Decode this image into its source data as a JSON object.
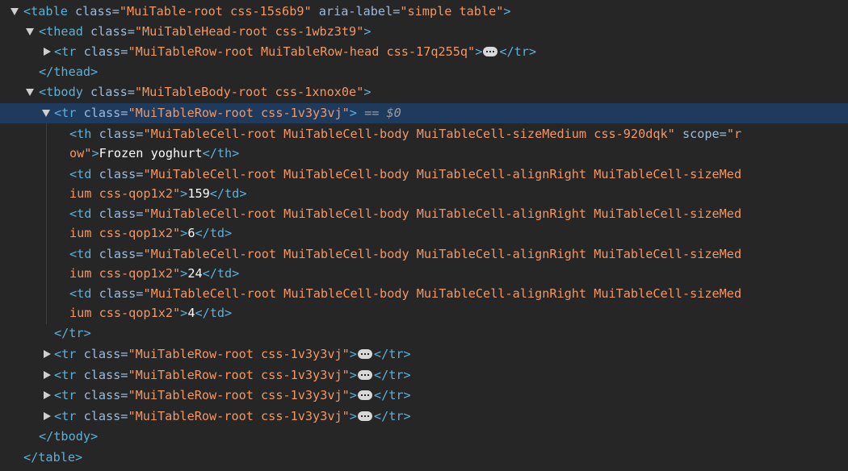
{
  "nodes": {
    "table_open": {
      "tag": "<table",
      "a1": " class=",
      "v1": "\"MuiTable-root css-15s6b9\"",
      "a2": " aria-label=",
      "v2": "\"simple table\"",
      "end": ">"
    },
    "thead_open": {
      "tag": "<thead",
      "a1": " class=",
      "v1": "\"MuiTableHead-root css-1wbz3t9\"",
      "end": ">"
    },
    "thead_tr": {
      "tag": "<tr",
      "a1": " class=",
      "v1": "\"MuiTableRow-root MuiTableRow-head css-17q255q\"",
      "end": ">",
      "close": "</tr>"
    },
    "thead_close": "</thead>",
    "tbody_open": {
      "tag": "<tbody",
      "a1": " class=",
      "v1": "\"MuiTableBody-root css-1xnox0e\"",
      "end": ">"
    },
    "tr_selected": {
      "tag": "<tr",
      "a1": " class=",
      "v1": "\"MuiTableRow-root css-1v3y3vj\"",
      "end": ">",
      "eq": " == ",
      "ref": "$0"
    },
    "th": {
      "tag": "<th",
      "a1": " class=",
      "v1": "\"MuiTableCell-root MuiTableCell-body MuiTableCell-sizeMedium css-920dqk\"",
      "a2": " scope=",
      "v2a": "\"r",
      "v2b": "ow\"",
      "end": ">",
      "text": "Frozen yoghurt",
      "close": "</th>"
    },
    "td_open_line": {
      "tag": "<td",
      "a1": " class=",
      "v1a": "\"MuiTableCell-root MuiTableCell-body MuiTableCell-alignRight MuiTableCell-sizeMed",
      "v1b": "ium css-qop1x2\"",
      "end": ">",
      "close": "</td>"
    },
    "td_values": [
      "159",
      "6",
      "24",
      "4"
    ],
    "tr_close": "</tr>",
    "collapsed_tr": {
      "tag": "<tr",
      "a1": " class=",
      "v1": "\"MuiTableRow-root css-1v3y3vj\"",
      "end": ">",
      "close": "</tr>"
    },
    "tbody_close": "</tbody>",
    "table_close": "</table>"
  },
  "colors": {
    "background": "#262626",
    "selection": "#1e3b5e",
    "tag": "#5db0d7",
    "attribute": "#9bbbdc",
    "value": "#f29766",
    "text": "#ffffff"
  },
  "icons": {
    "expanded": "triangle-down-icon",
    "collapsed": "triangle-right-icon",
    "ellipsis": "ellipsis-icon"
  }
}
